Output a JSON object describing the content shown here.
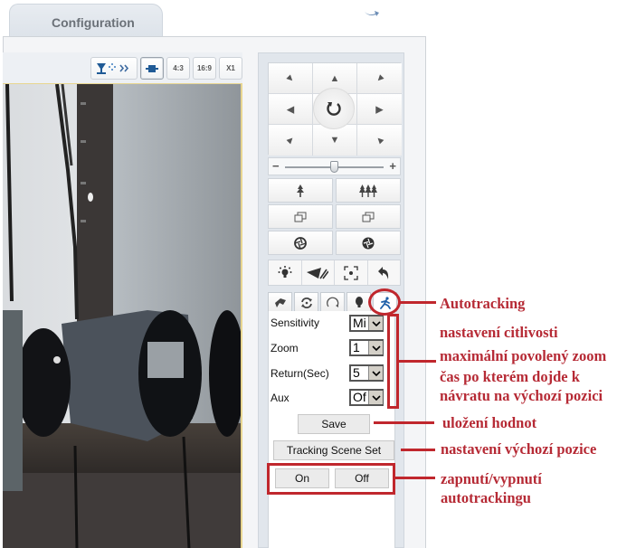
{
  "header": {
    "tab_label": "Configuration",
    "back_icon": "return-arrow-icon"
  },
  "video_toolbar": {
    "buttons": [
      {
        "label": "",
        "icon": "ptz-expand-icon"
      },
      {
        "label": "",
        "icon": "fit-window-icon",
        "active": true
      },
      {
        "label": "4:3"
      },
      {
        "label": "16:9"
      },
      {
        "label": "X1"
      }
    ]
  },
  "ptz": {
    "directions": [
      {
        "name": "up-left",
        "glyph": "◤"
      },
      {
        "name": "up",
        "glyph": "▲"
      },
      {
        "name": "up-right",
        "glyph": "◥"
      },
      {
        "name": "left",
        "glyph": "◀"
      },
      {
        "name": "auto",
        "glyph": "↻"
      },
      {
        "name": "right",
        "glyph": "▶"
      },
      {
        "name": "down-left",
        "glyph": "◣"
      },
      {
        "name": "down",
        "glyph": "▼"
      },
      {
        "name": "down-right",
        "glyph": "◢"
      }
    ],
    "speed": {
      "minus": "−",
      "plus": "+",
      "value_fraction": 0.5
    },
    "lens_buttons": [
      {
        "name": "zoom-in",
        "icon": "single-tree-icon",
        "glyph": "↟"
      },
      {
        "name": "zoom-out",
        "icon": "forest-icon",
        "glyph": "⇈"
      },
      {
        "name": "focus-near",
        "icon": "focus-near-icon",
        "glyph": "❐"
      },
      {
        "name": "focus-far",
        "icon": "focus-far-icon",
        "glyph": "❐"
      },
      {
        "name": "iris-open",
        "icon": "iris-open-icon",
        "glyph": "✪"
      },
      {
        "name": "iris-close",
        "icon": "iris-close-icon",
        "glyph": "✪"
      }
    ],
    "aux_buttons": [
      {
        "name": "light",
        "icon": "light-bulb-icon",
        "glyph": "✷"
      },
      {
        "name": "wiper",
        "icon": "wiper-icon",
        "glyph": "⫽"
      },
      {
        "name": "one-touch-focus",
        "icon": "focus-frame-icon",
        "glyph": "⊡"
      },
      {
        "name": "return",
        "icon": "undo-arrow-icon",
        "glyph": "↶"
      }
    ],
    "tabs": [
      {
        "name": "preset",
        "icon": "preset-flag-icon",
        "glyph": "⚑"
      },
      {
        "name": "cruise",
        "icon": "cruise-icon",
        "glyph": "⟳"
      },
      {
        "name": "pattern",
        "icon": "pattern-icon",
        "glyph": "↻"
      },
      {
        "name": "light",
        "icon": "bulb-icon",
        "glyph": "●"
      },
      {
        "name": "autotracking",
        "icon": "running-person-icon",
        "glyph": "🏃",
        "active": true
      }
    ]
  },
  "autotracking": {
    "fields": [
      {
        "label": "Sensitivity",
        "value": "Mi"
      },
      {
        "label": "Zoom",
        "value": "1"
      },
      {
        "label": "Return(Sec)",
        "value": "5"
      },
      {
        "label": "Aux",
        "value": "Of"
      }
    ],
    "save_label": "Save",
    "scene_set_label": "Tracking Scene Set",
    "on_label": "On",
    "off_label": "Off"
  },
  "annotations": {
    "autotracking": "Autotracking",
    "sensitivity": "nastavení citlivosti",
    "zoom": "maximální povolený zoom",
    "return_line1": "čas po kterém dojde k",
    "return_line2": "návratu na výchozí pozici",
    "save": "uložení hodnot",
    "scene": "nastavení výchozí pozice",
    "onoff_line1": "zapnutí/vypnutí",
    "onoff_line2": "autotrackingu",
    "color": "#c0272d"
  }
}
